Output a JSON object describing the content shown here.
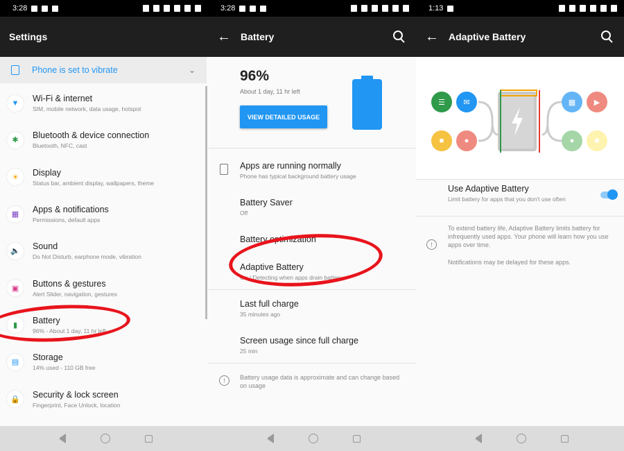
{
  "screen1": {
    "status_time": "3:28",
    "title": "Settings",
    "vibrate_label": "Phone is set to vibrate",
    "items": [
      {
        "title": "Wi-Fi & internet",
        "subtitle": "SIM, mobile network, data usage, hotspot",
        "icon": "wifi-icon"
      },
      {
        "title": "Bluetooth & device connection",
        "subtitle": "Bluetooth, NFC, cast",
        "icon": "bluetooth-icon"
      },
      {
        "title": "Display",
        "subtitle": "Status bar, ambient display, wallpapers, theme",
        "icon": "display-icon"
      },
      {
        "title": "Apps & notifications",
        "subtitle": "Permissions, default apps",
        "icon": "apps-icon"
      },
      {
        "title": "Sound",
        "subtitle": "Do Not Disturb, earphone mode, vibration",
        "icon": "sound-icon"
      },
      {
        "title": "Buttons & gestures",
        "subtitle": "Alert Slider, navigation, gestures",
        "icon": "buttons-icon"
      },
      {
        "title": "Battery",
        "subtitle": "96% - About 1 day, 11 hr left",
        "icon": "battery-icon"
      },
      {
        "title": "Storage",
        "subtitle": "14% used - 110 GB free",
        "icon": "storage-icon"
      },
      {
        "title": "Security & lock screen",
        "subtitle": "Fingerprint, Face Unlock, location",
        "icon": "lock-icon"
      }
    ]
  },
  "screen2": {
    "status_time": "3:28",
    "title": "Battery",
    "percent": "96%",
    "time_left": "About 1 day, 11 hr left",
    "detail_button": "VIEW DETAILED USAGE",
    "apps_title": "Apps are running normally",
    "apps_sub": "Phone has typical background battery usage",
    "saver_title": "Battery Saver",
    "saver_sub": "Off",
    "optim_title": "Battery optimization",
    "adaptive_title": "Adaptive Battery",
    "adaptive_sub": "On / Detecting when apps drain battery",
    "last_full_title": "Last full charge",
    "last_full_sub": "35 minutes ago",
    "screen_usage_title": "Screen usage since full charge",
    "screen_usage_sub": "25 min",
    "note": "Battery usage data is approximate and can change based on usage"
  },
  "screen3": {
    "status_time": "1:13",
    "title": "Adaptive Battery",
    "use_title": "Use Adaptive Battery",
    "use_sub": "Limit battery for apps that you don't use often",
    "toggle_on": true,
    "info1": "To extend battery life, Adaptive Battery limits battery for infrequently used apps. Your phone will learn how you use apps over time.",
    "info2": "Notifications may be delayed for these apps."
  },
  "colors": {
    "accent": "#2196f3",
    "annotation_red": "#e8141c",
    "appbar": "#1f1f1f"
  }
}
